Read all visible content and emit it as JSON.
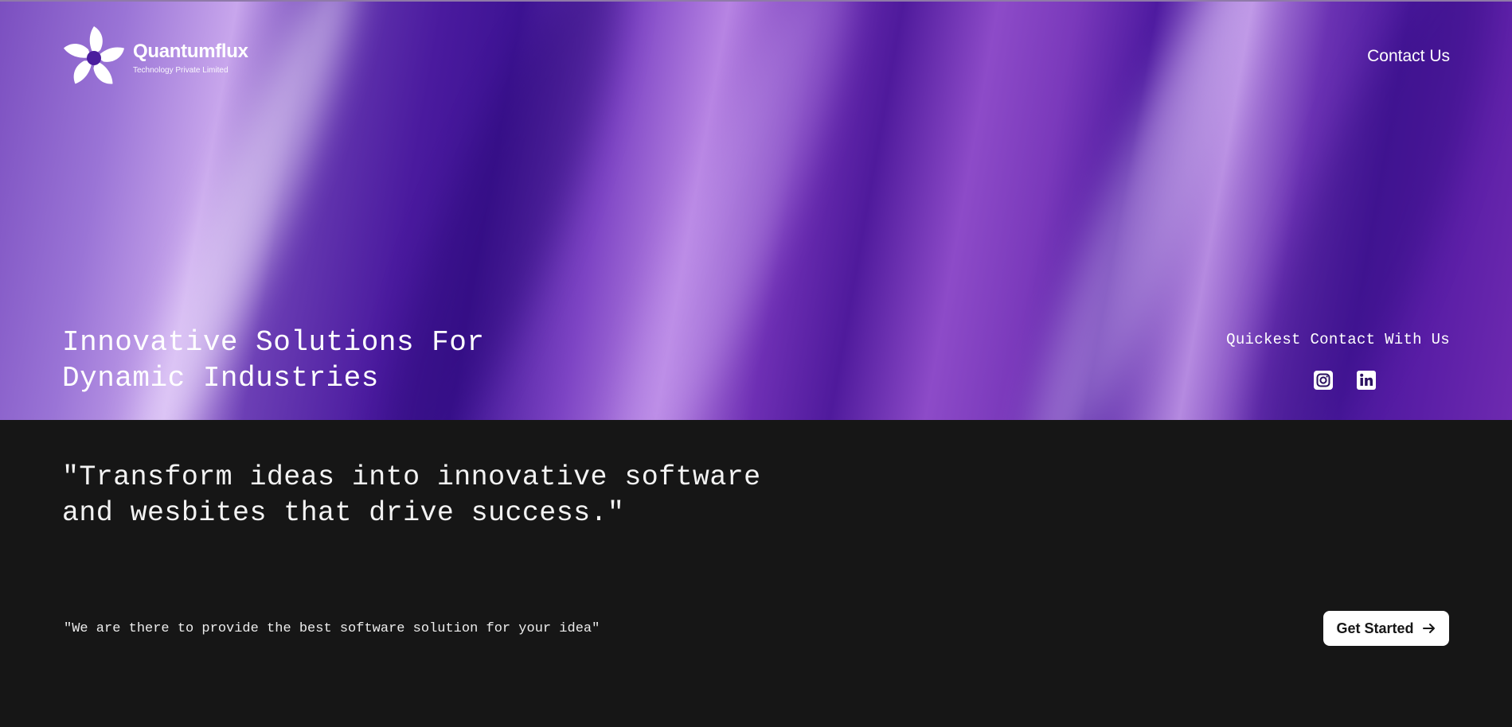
{
  "header": {
    "brand_name": "Quantumflux",
    "brand_subtitle": "Technology Private Limited",
    "logo_icon": "pinwheel-logo-icon",
    "contact_link": "Contact Us"
  },
  "hero": {
    "title": "Innovative Solutions For\nDynamic Industries",
    "quick_contact_label": "Quickest Contact With Us",
    "socials": [
      {
        "name": "instagram-icon"
      },
      {
        "name": "linkedin-icon"
      }
    ]
  },
  "main": {
    "quote": "\"Transform ideas into innovative software\nand wesbites that drive success.\"",
    "tagline": "\"We are there to provide the best software solution for your idea\"",
    "cta_label": "Get Started",
    "cta_icon": "arrow-right-icon"
  },
  "colors": {
    "page_background": "#161616",
    "hero_accent": "#5a1ea6",
    "button_background": "#ffffff",
    "button_text": "#161616"
  }
}
